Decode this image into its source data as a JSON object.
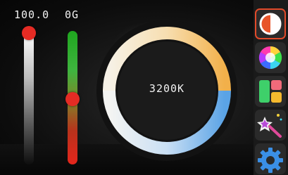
{
  "brightness": {
    "value_text": "100.0",
    "level_percent": 100
  },
  "green_magenta": {
    "value_text": "0G",
    "level_percent": 50
  },
  "cct": {
    "value_text": "3200K"
  },
  "sidebar": {
    "items": [
      {
        "icon": "cct-mode-icon",
        "active": true
      },
      {
        "icon": "hsi-color-wheel-icon",
        "active": false
      },
      {
        "icon": "color-swatches-icon",
        "active": false
      },
      {
        "icon": "effects-magic-wand-icon",
        "active": false
      },
      {
        "icon": "settings-gear-icon",
        "active": false
      }
    ]
  },
  "colors": {
    "knob": "#e52b24",
    "active_border": "#e14a2a",
    "warm": "#f2b04a",
    "cool": "#5aa3e6"
  }
}
